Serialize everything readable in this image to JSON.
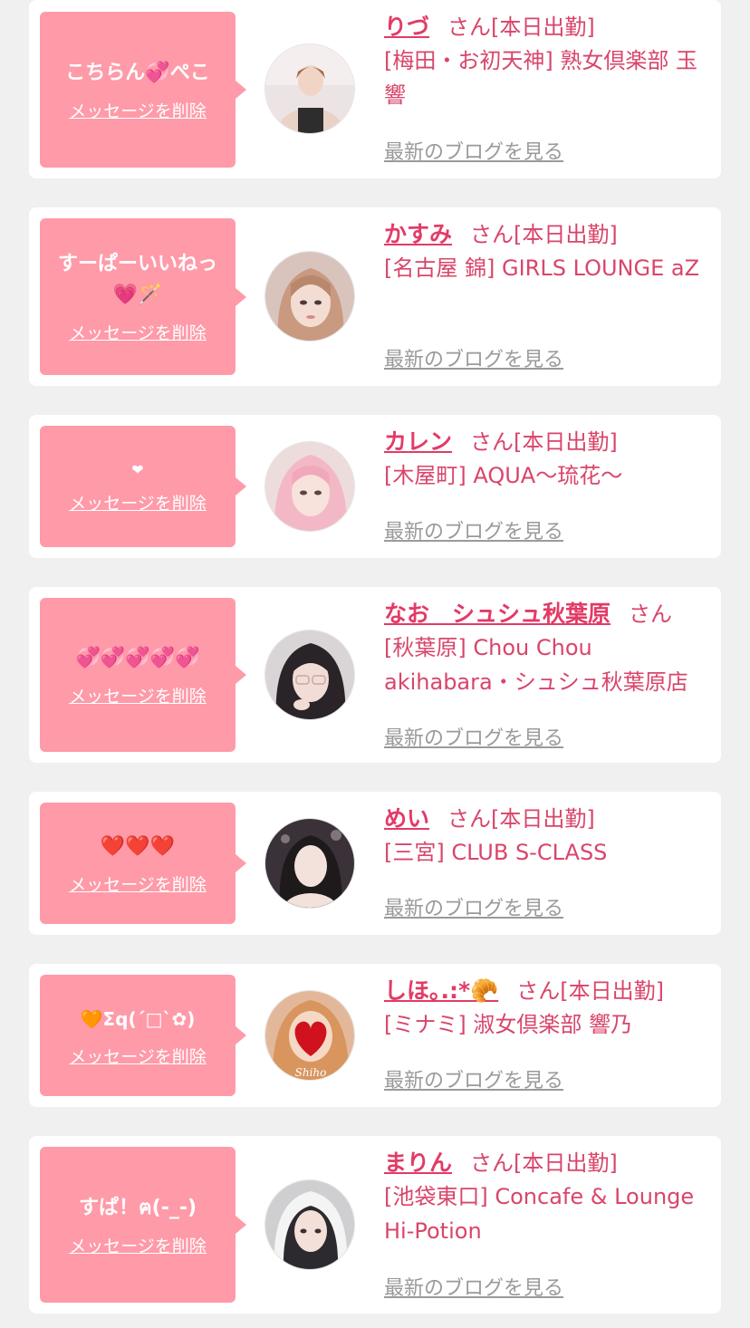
{
  "delete_label": "メッセージを削除",
  "blog_label": "最新のブログを見る",
  "colors": {
    "background": "#f0f0f0",
    "card": "#ffffff",
    "bubble": "#ff9aa8",
    "accent": "#e23b66",
    "muted": "#9a9a9a"
  },
  "cards": [
    {
      "message": "こちらん💞ぺこ",
      "name": "りづ",
      "san": "さん",
      "status": "[本日出勤]",
      "shop": "[梅田・お初天神] 熟女倶楽部 玉響"
    },
    {
      "message": "すーぱーいいねっ💗🪄",
      "name": "かすみ",
      "san": "さん",
      "status": "[本日出勤]",
      "shop": "[名古屋 錦] GIRLS LOUNGE aZ"
    },
    {
      "message": "❤︎",
      "name": "カレン",
      "san": "さん",
      "status": "[本日出勤]",
      "shop": "[木屋町] AQUA〜琉花〜"
    },
    {
      "message": "💞💞💞💞💞",
      "name": "なお　シュシュ秋葉原",
      "san": "さん",
      "status": "",
      "shop": "[秋葉原] Chou Chou akihabara・シュシュ秋葉原店"
    },
    {
      "message": "❤️❤️❤️",
      "name": "めい",
      "san": "さん",
      "status": "[本日出勤]",
      "shop": "[三宮] CLUB S-CLASS"
    },
    {
      "message": "🧡Σq(ˊ□ˋ✿)",
      "name": "しほ｡.:*🥐",
      "san": "さん",
      "status": "[本日出勤]",
      "shop": "[ミナミ] 淑女倶楽部 響乃"
    },
    {
      "message": "すぱ！ฅ(-_-)",
      "name": "まりん",
      "san": "さん",
      "status": "[本日出勤]",
      "shop": "[池袋東口] Concafe & Lounge Hi-Potion"
    }
  ]
}
